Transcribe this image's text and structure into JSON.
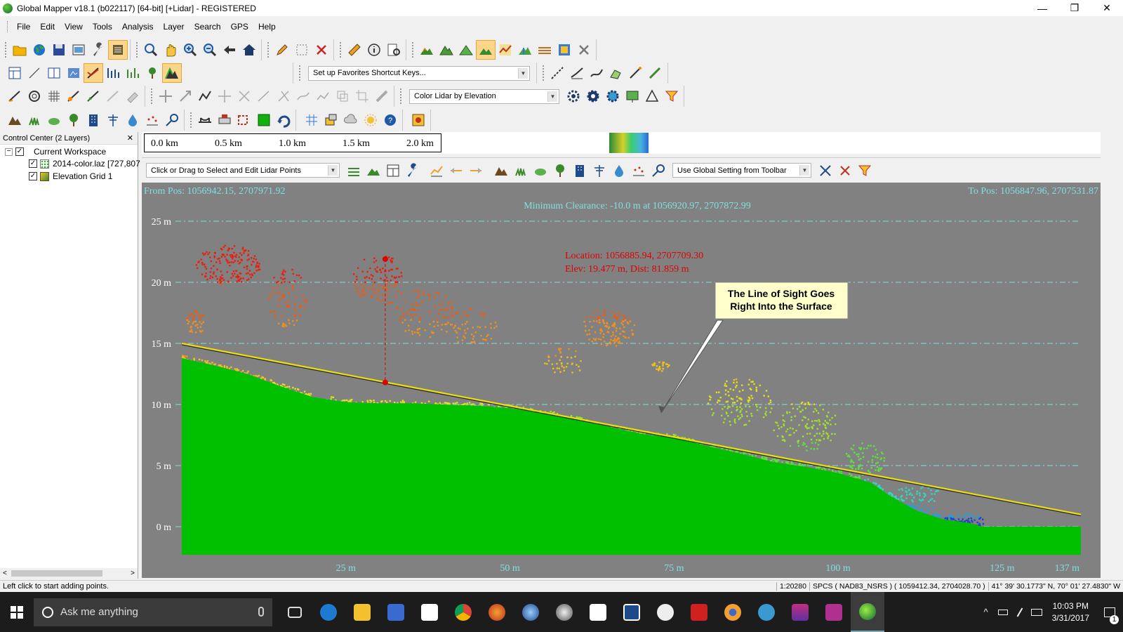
{
  "window": {
    "title": "Global Mapper v18.1 (b022117) [64-bit] [+Lidar] - REGISTERED",
    "minimize": "—",
    "restore": "❐",
    "close": "✕"
  },
  "menu": [
    "File",
    "Edit",
    "View",
    "Tools",
    "Analysis",
    "Layer",
    "Search",
    "GPS",
    "Help"
  ],
  "toolbar": {
    "favorites_combo": "Set up Favorites Shortcut Keys...",
    "lidar_color_combo": "Color Lidar by Elevation"
  },
  "control_center": {
    "title": "Control Center (2 Layers)",
    "close": "✕",
    "workspace": "Current Workspace",
    "layers": [
      {
        "name": "2014-color.laz [727,807",
        "checked": "✓"
      },
      {
        "name": "Elevation Grid 1",
        "checked": "✓"
      }
    ],
    "workspace_checked": "✓",
    "tree_toggle": "−",
    "scroll_left": "<",
    "scroll_right": ">"
  },
  "scale_bar": [
    "0.0 km",
    "0.5 km",
    "1.0 km",
    "1.5 km",
    "2.0 km"
  ],
  "profile_toolbar": {
    "mode_combo": "Click or Drag to Select and Edit Lidar Points",
    "setting_combo": "Use Global Setting from Toolbar"
  },
  "profile": {
    "from_pos": "From Pos: 1056942.15, 2707971.92",
    "to_pos": "To Pos: 1056847.96, 2707531.87",
    "min_clearance": "Minimum Clearance: -10.0 m at 1056920.97, 2707872.99",
    "location": "Location: 1056885.94, 2707709.30",
    "elev_dist": "Elev: 19.477 m, Dist: 81.859 m",
    "callout_line1": "The Line of Sight Goes",
    "callout_line2": "Right Into the Surface",
    "colors": {
      "background": "#818181",
      "terrain": "#00c000",
      "grid": "#7fe0e0",
      "axis_text": "#ffffff",
      "header_text": "#7fe0e0",
      "marker": "#e00000",
      "line_of_sight": "#f0e000"
    }
  },
  "chart_data": {
    "type": "area",
    "xlabel": "",
    "ylabel": "",
    "x_ticks": [
      "25 m",
      "50 m",
      "75 m",
      "100 m",
      "125 m",
      "137 m"
    ],
    "y_ticks": [
      "0 m",
      "5 m",
      "10 m",
      "15 m",
      "20 m",
      "25 m"
    ],
    "xlim": [
      0,
      137
    ],
    "ylim": [
      -2.3,
      25
    ],
    "grid": true,
    "terrain_profile": {
      "x": [
        0,
        5,
        10,
        15,
        20,
        25,
        30,
        35,
        40,
        45,
        50,
        55,
        60,
        65,
        70,
        75,
        80,
        85,
        90,
        95,
        100,
        105,
        108,
        112,
        116,
        120,
        122,
        137
      ],
      "y": [
        13.8,
        13.2,
        12.5,
        11.5,
        10.6,
        10.2,
        10.1,
        10.1,
        10.0,
        9.9,
        9.7,
        9.3,
        8.8,
        8.2,
        7.6,
        7.3,
        6.6,
        6.0,
        5.3,
        4.9,
        4.4,
        3.6,
        2.5,
        1.3,
        0.6,
        0.3,
        0.0,
        0.0
      ]
    },
    "line_of_sight": {
      "x": [
        0,
        137
      ],
      "y": [
        15.0,
        1.0
      ]
    },
    "selected_point": {
      "x": 31,
      "y": 11.8,
      "top_y": 21.9
    }
  },
  "status": {
    "hint": "Left click to start adding points.",
    "scale": "1:20280",
    "projection": "SPCS ( NAD83_NSRS ) ( 1059412.34, 2704028.70 )",
    "latlon": "41° 39' 30.1773\" N, 70° 01' 27.4830\" W"
  },
  "taskbar": {
    "search_placeholder": "Ask me anything",
    "time": "10:03 PM",
    "date": "3/31/2017",
    "notification_count": "1",
    "tray_up": "^"
  }
}
